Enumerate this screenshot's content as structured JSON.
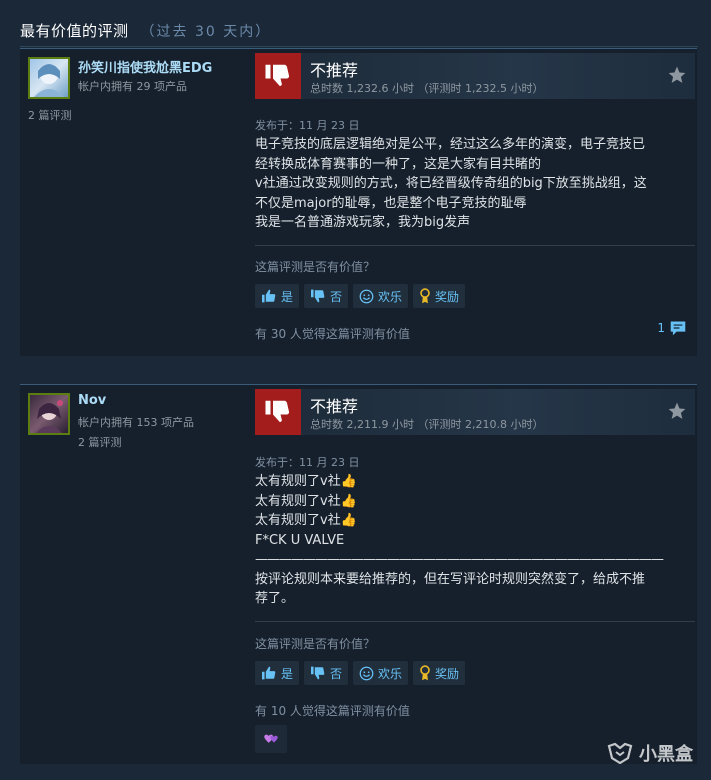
{
  "section": {
    "title": "最有价值的评测",
    "subtitle": "（过去 30 天内）"
  },
  "reviews": [
    {
      "author_name": "孙笑川指使我尬黑EDG",
      "products": "帐户内拥有 29 项产品",
      "review_count": "2 篇评测",
      "verdict": "不推荐",
      "hours": "总时数 1,232.6 小时 （评测时 1,232.5 小时）",
      "posted": "发布于：11 月 23 日",
      "lines": [
        "电子竞技的底层逻辑绝对是公平，经过这么多年的演变，电子竞技已",
        "经转换成体育赛事的一种了，这是大家有目共睹的",
        "v社通过改变规则的方式，将已经晋级传奇组的big下放至挑战组，这",
        "不仅是major的耻辱，也是整个电子竞技的耻辱",
        "我是一名普通游戏玩家，我为big发声"
      ],
      "helpful_question": "这篇评测是否有价值？",
      "btn_yes": "是",
      "btn_no": "否",
      "btn_funny": "欢乐",
      "btn_award": "奖励",
      "found_helpful": "有 30 人觉得这篇评测有价值",
      "comment_count": "1"
    },
    {
      "author_name": "Nov",
      "products": "帐户内拥有 153 项产品",
      "review_count": "2 篇评测",
      "verdict": "不推荐",
      "hours": "总时数 2,211.9 小时 （评测时 2,210.8 小时）",
      "posted": "发布于：11 月 23 日",
      "lines": [
        "太有规则了v社👍",
        "太有规则了v社👍",
        "太有规则了v社👍",
        "F*CK U VALVE",
        "——————————————————————————————————",
        "按评论规则本来要给推荐的，但在写评论时规则突然变了，给成不推",
        "荐了。"
      ],
      "helpful_question": "这篇评测是否有价值？",
      "btn_yes": "是",
      "btn_no": "否",
      "btn_funny": "欢乐",
      "btn_award": "奖励",
      "found_helpful": "有 10 人觉得这篇评测有价值"
    }
  ],
  "watermark": "小黑盒",
  "colors": {
    "background": "#1b2838",
    "panel": "#16202d",
    "not_recommended": "#a31d1d",
    "link": "#67c1f5",
    "author": "#acdbf5"
  }
}
